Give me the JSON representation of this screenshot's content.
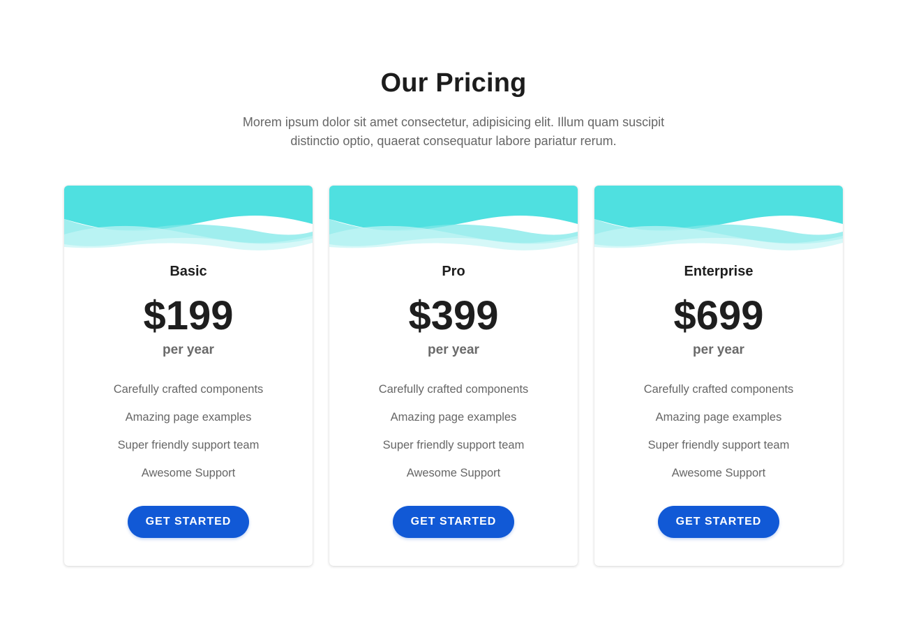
{
  "header": {
    "title": "Our Pricing",
    "subtitle": "Morem ipsum dolor sit amet consectetur, adipisicing elit. Illum quam suscipit distinctio optio, quaerat consequatur labore pariatur rerum."
  },
  "colors": {
    "wave_primary": "#4fe0e0",
    "wave_light": "#a6eeee",
    "button": "#1159d6"
  },
  "plans": [
    {
      "name": "Basic",
      "price": "$199",
      "period": "per year",
      "features": [
        "Carefully crafted components",
        "Amazing page examples",
        "Super friendly support team",
        "Awesome Support"
      ],
      "cta": "GET STARTED"
    },
    {
      "name": "Pro",
      "price": "$399",
      "period": "per year",
      "features": [
        "Carefully crafted components",
        "Amazing page examples",
        "Super friendly support team",
        "Awesome Support"
      ],
      "cta": "GET STARTED"
    },
    {
      "name": "Enterprise",
      "price": "$699",
      "period": "per year",
      "features": [
        "Carefully crafted components",
        "Amazing page examples",
        "Super friendly support team",
        "Awesome Support"
      ],
      "cta": "GET STARTED"
    }
  ]
}
